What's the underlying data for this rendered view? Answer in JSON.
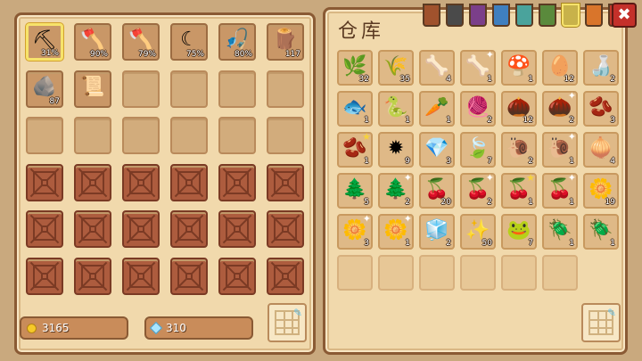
{
  "title": "仓库",
  "currency": {
    "gold": "3165",
    "gems": "310"
  },
  "close_label": "✖",
  "tabs": [
    {
      "color": "#a0522d",
      "active": false
    },
    {
      "color": "#4a4a4a",
      "active": false
    },
    {
      "color": "#7b3f8a",
      "active": false
    },
    {
      "color": "#3f7fbf",
      "active": false
    },
    {
      "color": "#4aa39c",
      "active": false
    },
    {
      "color": "#5a8a3c",
      "active": false
    },
    {
      "color": "#c8b24a",
      "active": true
    },
    {
      "color": "#d9752b",
      "active": false
    },
    {
      "color": "#c0392b",
      "active": false
    }
  ],
  "inventory": [
    {
      "icon": "pickaxe-icon",
      "glyph": "⛏",
      "label": "31%",
      "selected": true
    },
    {
      "icon": "axe-icon",
      "glyph": "🪓",
      "label": "90%"
    },
    {
      "icon": "red-axe-icon",
      "glyph": "🪓",
      "label": "79%"
    },
    {
      "icon": "scythe-icon",
      "glyph": "☾",
      "label": "75%"
    },
    {
      "icon": "fishing-rod-icon",
      "glyph": "🎣",
      "label": "80%"
    },
    {
      "icon": "wood-icon",
      "glyph": "🪵",
      "label": "117"
    },
    {
      "icon": "stone-icon",
      "glyph": "🪨",
      "label": "87"
    },
    {
      "icon": "scroll-icon",
      "glyph": "📜",
      "label": ""
    }
  ],
  "storage": [
    {
      "icon": "grass-icon",
      "glyph": "🌿",
      "qty": "32"
    },
    {
      "icon": "wheat-icon",
      "glyph": "🌾",
      "qty": "35"
    },
    {
      "icon": "bone-icon",
      "glyph": "🦴",
      "qty": "4"
    },
    {
      "icon": "bone-star-icon",
      "glyph": "🦴",
      "qty": "1",
      "star": "✦"
    },
    {
      "icon": "mushroom-icon",
      "glyph": "🍄",
      "qty": "1"
    },
    {
      "icon": "egg-icon",
      "glyph": "🥚",
      "qty": "12"
    },
    {
      "icon": "bottle-icon",
      "glyph": "🍶",
      "qty": "2"
    },
    {
      "icon": "fish-icon",
      "glyph": "🐟",
      "qty": "1"
    },
    {
      "icon": "eel-icon",
      "glyph": "🐍",
      "qty": "1"
    },
    {
      "icon": "carrot-icon",
      "glyph": "🥕",
      "qty": "1"
    },
    {
      "icon": "mesh-icon",
      "glyph": "🧶",
      "qty": "2"
    },
    {
      "icon": "walnut-icon",
      "glyph": "🌰",
      "qty": "12"
    },
    {
      "icon": "walnut-star-icon",
      "glyph": "🌰",
      "qty": "2",
      "star": "✦"
    },
    {
      "icon": "seed-pod-icon",
      "glyph": "🫘",
      "qty": "3"
    },
    {
      "icon": "seed-pod-gold-icon",
      "glyph": "🫘",
      "qty": "1",
      "star": "★"
    },
    {
      "icon": "urchin-icon",
      "glyph": "✹",
      "qty": "9"
    },
    {
      "icon": "gem-stone-icon",
      "glyph": "💎",
      "qty": "3"
    },
    {
      "icon": "leaf-icon",
      "glyph": "🍃",
      "qty": "7"
    },
    {
      "icon": "snail-icon",
      "glyph": "🐌",
      "qty": "2"
    },
    {
      "icon": "snail-star-icon",
      "glyph": "🐌",
      "qty": "1",
      "star": "✦"
    },
    {
      "icon": "onion-icon",
      "glyph": "🧅",
      "qty": "4"
    },
    {
      "icon": "pinecone-icon",
      "glyph": "🌲",
      "qty": "5"
    },
    {
      "icon": "pinecone-star-icon",
      "glyph": "🌲",
      "qty": "2",
      "star": "✦"
    },
    {
      "icon": "cherry-icon",
      "glyph": "🍒",
      "qty": "20"
    },
    {
      "icon": "cherry-star-icon",
      "glyph": "🍒",
      "qty": "2",
      "star": "✦"
    },
    {
      "icon": "cherry-gold-icon",
      "glyph": "🍒",
      "qty": "1",
      "star": "★"
    },
    {
      "icon": "cherry-purple-icon",
      "glyph": "🍒",
      "qty": "1",
      "star": "✦"
    },
    {
      "icon": "herb-icon",
      "glyph": "🌼",
      "qty": "19"
    },
    {
      "icon": "herb-star-icon",
      "glyph": "🌼",
      "qty": "3",
      "star": "✦"
    },
    {
      "icon": "herb-purple-icon",
      "glyph": "🌼",
      "qty": "1",
      "star": "✦"
    },
    {
      "icon": "salt-crystal-icon",
      "glyph": "🧊",
      "qty": "2"
    },
    {
      "icon": "sparkles-icon",
      "glyph": "✨",
      "qty": "50"
    },
    {
      "icon": "frog-icon",
      "glyph": "🐸",
      "qty": "7"
    },
    {
      "icon": "blue-beetle-icon",
      "glyph": "🪲",
      "qty": "1"
    },
    {
      "icon": "green-beetle-icon",
      "glyph": "🪲",
      "qty": "1"
    }
  ]
}
